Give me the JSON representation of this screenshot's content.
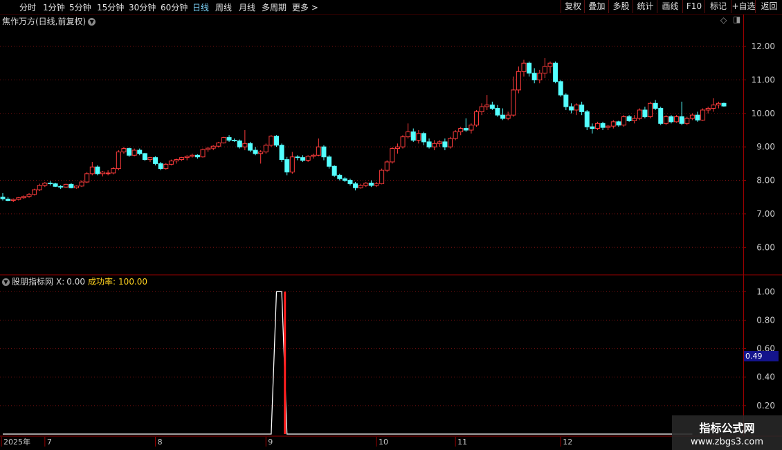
{
  "toolbar": {
    "periods": [
      "分时",
      "1分钟",
      "5分钟",
      "15分钟",
      "30分钟",
      "60分钟",
      "日线",
      "周线",
      "月线",
      "多周期",
      "更多 >"
    ],
    "active_period": "日线",
    "right_buttons": [
      "复权",
      "叠加",
      "多股",
      "统计",
      "画线",
      "F10",
      "标记",
      "+自选",
      "返回"
    ]
  },
  "main_panel": {
    "title": "焦作万方(日线,前复权)",
    "diamond_icon": "diamond-icon",
    "layout_icon": "layout-toggle-icon"
  },
  "indicator_panel": {
    "name": "股朋指标网",
    "x_label": "X:",
    "x_value": "0.00",
    "success_label": "成功率:",
    "success_value": "100.00",
    "cursor_value": "0.49"
  },
  "watermark": {
    "line1": "指标公式网",
    "line2": "www.zbgs3.com"
  },
  "colors": {
    "up": "#ff3c3c",
    "down": "#54ffff",
    "grid": "#7a1010",
    "axis_text": "#c8c8c8",
    "indicator_line": "#ffffff",
    "signal": "#ff1f1f"
  },
  "chart_data": [
    {
      "type": "candlestick",
      "title": "焦作万方(日线,前复权)",
      "ylim": [
        5.2,
        12.6
      ],
      "y_ticks": [
        "12.00",
        "11.00",
        "10.00",
        "9.00",
        "8.00",
        "7.00",
        "6.00"
      ],
      "y_tick_values": [
        12,
        11,
        10,
        9,
        8,
        7,
        6
      ],
      "x_ticks": [
        "2025年",
        "7",
        "8",
        "9",
        "10",
        "11",
        "12"
      ],
      "x_tick_index": [
        0,
        8,
        29,
        50,
        71,
        86,
        106
      ],
      "ohlc": [
        [
          7.5,
          7.62,
          7.4,
          7.45
        ],
        [
          7.44,
          7.5,
          7.38,
          7.4
        ],
        [
          7.4,
          7.46,
          7.35,
          7.43
        ],
        [
          7.43,
          7.5,
          7.4,
          7.48
        ],
        [
          7.48,
          7.55,
          7.45,
          7.52
        ],
        [
          7.52,
          7.62,
          7.48,
          7.58
        ],
        [
          7.58,
          7.75,
          7.55,
          7.72
        ],
        [
          7.72,
          7.9,
          7.68,
          7.85
        ],
        [
          7.85,
          7.95,
          7.8,
          7.92
        ],
        [
          7.92,
          7.98,
          7.85,
          7.9
        ],
        [
          7.9,
          7.93,
          7.8,
          7.82
        ],
        [
          7.82,
          7.86,
          7.74,
          7.8
        ],
        [
          7.8,
          7.9,
          7.78,
          7.88
        ],
        [
          7.88,
          7.92,
          7.76,
          7.78
        ],
        [
          7.78,
          7.85,
          7.75,
          7.83
        ],
        [
          7.83,
          8.0,
          7.8,
          7.95
        ],
        [
          7.95,
          8.25,
          7.92,
          8.2
        ],
        [
          8.2,
          8.55,
          8.15,
          8.4
        ],
        [
          8.4,
          8.45,
          8.15,
          8.2
        ],
        [
          8.2,
          8.28,
          8.12,
          8.25
        ],
        [
          8.2,
          8.3,
          8.15,
          8.22
        ],
        [
          8.22,
          8.4,
          8.18,
          8.35
        ],
        [
          8.35,
          8.9,
          8.3,
          8.85
        ],
        [
          8.85,
          9.0,
          8.8,
          8.95
        ],
        [
          8.95,
          8.98,
          8.7,
          8.75
        ],
        [
          8.75,
          8.95,
          8.72,
          8.9
        ],
        [
          8.9,
          8.95,
          8.75,
          8.8
        ],
        [
          8.8,
          8.82,
          8.58,
          8.62
        ],
        [
          8.62,
          8.7,
          8.55,
          8.68
        ],
        [
          8.68,
          8.72,
          8.45,
          8.5
        ],
        [
          8.5,
          8.55,
          8.3,
          8.35
        ],
        [
          8.35,
          8.52,
          8.32,
          8.48
        ],
        [
          8.48,
          8.62,
          8.45,
          8.58
        ],
        [
          8.58,
          8.65,
          8.5,
          8.62
        ],
        [
          8.62,
          8.7,
          8.58,
          8.68
        ],
        [
          8.68,
          8.75,
          8.6,
          8.72
        ],
        [
          8.72,
          8.8,
          8.68,
          8.75
        ],
        [
          8.75,
          8.78,
          8.65,
          8.7
        ],
        [
          8.7,
          8.95,
          8.68,
          8.92
        ],
        [
          8.92,
          9.0,
          8.85,
          8.96
        ],
        [
          8.96,
          9.05,
          8.9,
          9.02
        ],
        [
          9.02,
          9.15,
          8.98,
          9.12
        ],
        [
          9.12,
          9.3,
          9.1,
          9.28
        ],
        [
          9.28,
          9.35,
          9.15,
          9.2
        ],
        [
          9.2,
          9.25,
          9.15,
          9.18
        ],
        [
          9.18,
          9.22,
          8.95,
          9.0
        ],
        [
          9.0,
          9.5,
          8.9,
          9.1
        ],
        [
          9.1,
          9.15,
          8.85,
          8.9
        ],
        [
          8.9,
          9.0,
          8.75,
          8.8
        ],
        [
          8.8,
          8.9,
          8.5,
          8.85
        ],
        [
          8.85,
          9.1,
          8.8,
          9.05
        ],
        [
          9.05,
          9.35,
          9.0,
          9.32
        ],
        [
          9.32,
          9.35,
          9.0,
          9.05
        ],
        [
          9.05,
          9.1,
          8.55,
          8.62
        ],
        [
          8.62,
          8.7,
          8.15,
          8.25
        ],
        [
          8.25,
          8.85,
          8.2,
          8.7
        ],
        [
          8.7,
          8.75,
          8.6,
          8.68
        ],
        [
          8.68,
          8.75,
          8.55,
          8.6
        ],
        [
          8.6,
          8.75,
          8.55,
          8.72
        ],
        [
          8.72,
          8.8,
          8.65,
          8.75
        ],
        [
          8.75,
          9.25,
          8.72,
          9.0
        ],
        [
          9.0,
          9.05,
          8.6,
          8.7
        ],
        [
          8.7,
          8.75,
          8.35,
          8.42
        ],
        [
          8.42,
          8.45,
          8.1,
          8.15
        ],
        [
          8.15,
          8.2,
          8.0,
          8.05
        ],
        [
          8.05,
          8.1,
          7.95,
          8.0
        ],
        [
          8.0,
          8.05,
          7.85,
          7.9
        ],
        [
          7.9,
          7.95,
          7.7,
          7.78
        ],
        [
          7.78,
          7.9,
          7.75,
          7.85
        ],
        [
          7.85,
          7.95,
          7.8,
          7.92
        ],
        [
          7.92,
          8.0,
          7.8,
          7.85
        ],
        [
          7.85,
          7.95,
          7.8,
          7.9
        ],
        [
          7.9,
          8.35,
          7.88,
          8.3
        ],
        [
          8.3,
          8.6,
          8.25,
          8.55
        ],
        [
          8.55,
          9.0,
          8.5,
          8.95
        ],
        [
          8.95,
          9.1,
          8.8,
          9.0
        ],
        [
          9.0,
          9.35,
          8.95,
          9.3
        ],
        [
          9.3,
          9.7,
          9.25,
          9.45
        ],
        [
          9.45,
          9.55,
          9.15,
          9.2
        ],
        [
          9.2,
          9.5,
          9.1,
          9.4
        ],
        [
          9.4,
          9.45,
          9.05,
          9.15
        ],
        [
          9.15,
          9.25,
          8.95,
          9.0
        ],
        [
          9.0,
          9.2,
          8.9,
          9.1
        ],
        [
          9.1,
          9.2,
          9.0,
          9.15
        ],
        [
          9.15,
          9.25,
          8.9,
          9.0
        ],
        [
          9.0,
          9.3,
          8.95,
          9.25
        ],
        [
          9.25,
          9.5,
          9.2,
          9.45
        ],
        [
          9.45,
          9.6,
          9.35,
          9.55
        ],
        [
          9.55,
          9.85,
          9.45,
          9.5
        ],
        [
          9.5,
          9.7,
          9.4,
          9.65
        ],
        [
          9.65,
          10.1,
          9.6,
          10.05
        ],
        [
          10.05,
          10.3,
          9.95,
          10.2
        ],
        [
          10.2,
          10.55,
          10.1,
          10.25
        ],
        [
          10.25,
          10.35,
          10.1,
          10.15
        ],
        [
          10.15,
          10.25,
          9.9,
          9.95
        ],
        [
          9.95,
          10.15,
          9.8,
          9.85
        ],
        [
          9.85,
          10.05,
          9.8,
          9.95
        ],
        [
          9.95,
          11.1,
          9.9,
          10.7
        ],
        [
          10.7,
          11.4,
          10.6,
          11.25
        ],
        [
          11.25,
          11.6,
          11.1,
          11.5
        ],
        [
          11.5,
          11.55,
          11.1,
          11.2
        ],
        [
          11.2,
          11.35,
          10.9,
          11.0
        ],
        [
          11.0,
          11.3,
          10.9,
          11.2
        ],
        [
          11.2,
          11.65,
          11.05,
          11.4
        ],
        [
          11.4,
          11.55,
          11.2,
          11.5
        ],
        [
          11.5,
          11.55,
          10.9,
          10.95
        ],
        [
          10.95,
          11.0,
          10.5,
          10.55
        ],
        [
          10.55,
          10.6,
          10.1,
          10.2
        ],
        [
          10.2,
          10.3,
          10.0,
          10.1
        ],
        [
          10.1,
          10.3,
          9.95,
          10.25
        ],
        [
          10.25,
          10.35,
          9.95,
          10.05
        ],
        [
          10.05,
          10.1,
          9.5,
          9.6
        ],
        [
          9.6,
          9.7,
          9.4,
          9.55
        ],
        [
          9.55,
          9.75,
          9.5,
          9.7
        ],
        [
          9.7,
          9.75,
          9.5,
          9.58
        ],
        [
          9.58,
          9.65,
          9.5,
          9.62
        ],
        [
          9.62,
          9.8,
          9.55,
          9.75
        ],
        [
          9.75,
          9.78,
          9.6,
          9.65
        ],
        [
          9.65,
          9.95,
          9.6,
          9.9
        ],
        [
          9.9,
          9.95,
          9.75,
          9.78
        ],
        [
          9.78,
          9.95,
          9.7,
          9.85
        ],
        [
          9.85,
          10.15,
          9.8,
          10.1
        ],
        [
          10.1,
          10.2,
          9.85,
          9.9
        ],
        [
          9.9,
          10.35,
          9.85,
          10.3
        ],
        [
          10.3,
          10.4,
          10.1,
          10.15
        ],
        [
          10.15,
          10.2,
          9.65,
          9.7
        ],
        [
          9.7,
          9.95,
          9.65,
          9.9
        ],
        [
          9.9,
          9.95,
          9.7,
          9.75
        ],
        [
          9.75,
          9.95,
          9.72,
          9.9
        ],
        [
          9.9,
          10.35,
          9.65,
          9.7
        ],
        [
          9.7,
          9.9,
          9.65,
          9.85
        ],
        [
          9.85,
          10.0,
          9.8,
          9.95
        ],
        [
          9.95,
          10.05,
          9.75,
          9.8
        ],
        [
          9.8,
          10.15,
          9.78,
          10.1
        ],
        [
          10.1,
          10.2,
          10.0,
          10.15
        ],
        [
          10.15,
          10.45,
          10.05,
          10.25
        ],
        [
          10.25,
          10.35,
          10.15,
          10.3
        ],
        [
          10.3,
          10.32,
          10.2,
          10.22
        ]
      ]
    },
    {
      "type": "line",
      "title": "股朋指标网",
      "ylim": [
        0,
        1.05
      ],
      "y_ticks": [
        "1.00",
        "0.80",
        "0.60",
        "0.40",
        "0.20"
      ],
      "y_tick_values": [
        1.0,
        0.8,
        0.6,
        0.4,
        0.2
      ],
      "series": [
        {
          "points": [
            [
              0,
              0
            ],
            [
              51,
              0
            ],
            [
              52,
              1.0
            ],
            [
              53,
              1.0
            ],
            [
              54,
              0
            ],
            [
              131,
              0
            ]
          ]
        }
      ],
      "signal_index": 54
    }
  ]
}
